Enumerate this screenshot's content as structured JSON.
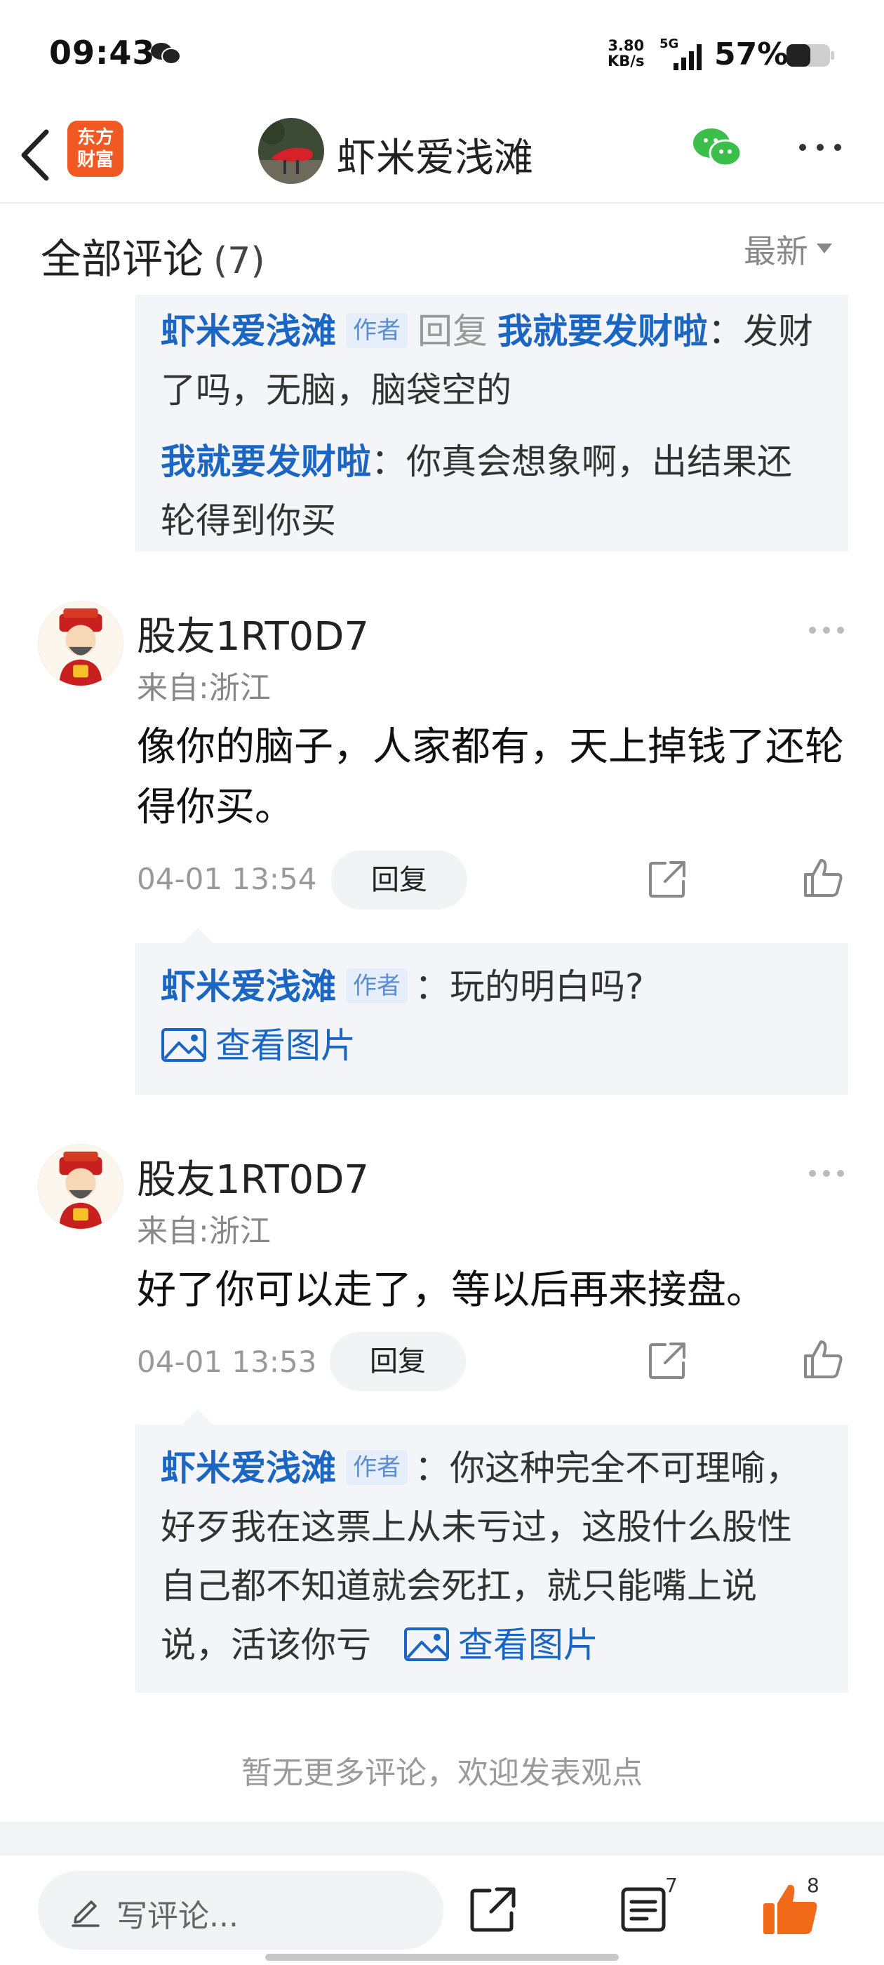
{
  "status_bar": {
    "time": "09:43",
    "net_speed_value": "3.80",
    "net_speed_unit": "KB/s",
    "network": "5G",
    "battery": "57%"
  },
  "header": {
    "logo_line1": "东方",
    "logo_line2": "财富",
    "title": "虾米爱浅滩"
  },
  "section": {
    "title": "全部评论",
    "count": "(7)",
    "sort": "最新"
  },
  "thread_top": {
    "r1_user": "虾米爱浅滩",
    "r1_tag": "作者",
    "r1_reply_word": "回复",
    "r1_target": "我就要发财啦",
    "r1_text": "：发财了吗，无脑，脑袋空的",
    "r2_user": "我就要发财啦",
    "r2_text": "：你真会想象啊，出结果还轮得到你买"
  },
  "comments": [
    {
      "user": "股友1RT0D7",
      "location": "来自:浙江",
      "text": "像你的脑子，人家都有，天上掉钱了还轮得你买。",
      "time": "04-01 13:54",
      "reply_label": "回复",
      "reply_user": "虾米爱浅滩",
      "reply_tag": "作者",
      "reply_text": "：玩的明白吗?",
      "reply_view_image": "查看图片"
    },
    {
      "user": "股友1RT0D7",
      "location": "来自:浙江",
      "text": "好了你可以走了，等以后再来接盘。",
      "time": "04-01 13:53",
      "reply_label": "回复",
      "reply_user": "虾米爱浅滩",
      "reply_tag": "作者",
      "reply_text": "：你这种完全不可理喻，好歹我在这票上从未亏过，这股什么股性自己都不知道就会死扛，就只能嘴上说说，活该你亏",
      "reply_view_image": "查看图片"
    }
  ],
  "footer": {
    "no_more": "暂无更多评论，欢迎发表观点"
  },
  "bottom_bar": {
    "input_placeholder": "写评论...",
    "comment_count": "7",
    "like_count": "8"
  },
  "colors": {
    "accent_blue": "#1a66c2",
    "like_orange": "#f06a1a",
    "logo_orange": "#f05a22"
  }
}
